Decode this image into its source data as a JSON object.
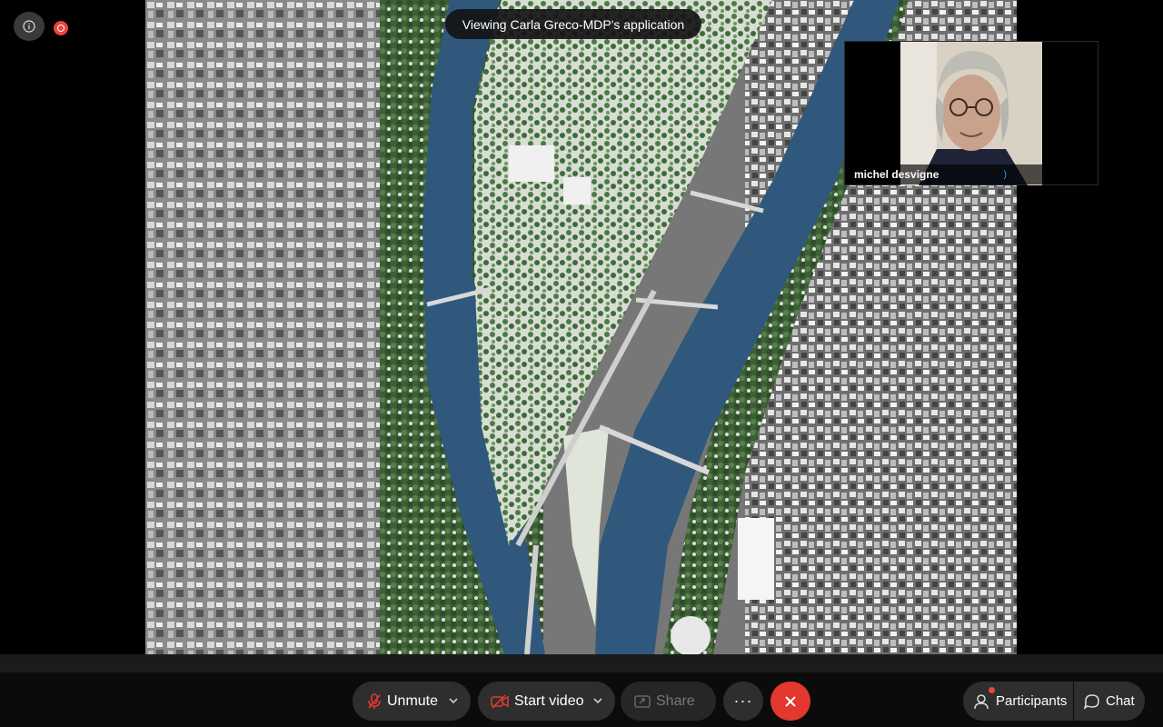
{
  "banner": {
    "text": "Viewing Carla Greco-MDP's application"
  },
  "participant": {
    "name": "michel desvigne"
  },
  "toolbar": {
    "unmute_label": "Unmute",
    "start_video_label": "Start video",
    "share_label": "Share",
    "more_label": "···",
    "participants_label": "Participants",
    "chat_label": "Chat"
  },
  "colors": {
    "leave_red": "#e2382f",
    "recording_red": "#e8453c",
    "river_blue": "#2f587c",
    "audio_blue": "#37a1ff"
  },
  "icons": [
    "info-icon",
    "recording-icon",
    "microphone-muted-icon",
    "camera-off-icon",
    "share-screen-icon",
    "close-icon",
    "participants-icon",
    "chat-icon",
    "chevron-down-icon"
  ]
}
